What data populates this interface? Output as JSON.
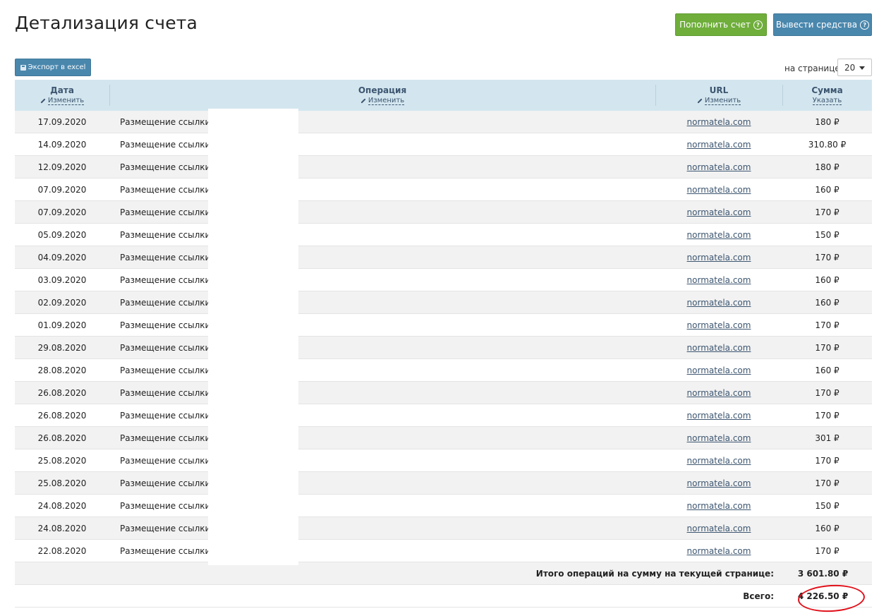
{
  "header": {
    "title": "Детализация счета",
    "topup_label": "Пополнить счет",
    "withdraw_label": "Вывести средства",
    "help_glyph": "?"
  },
  "toolbar": {
    "export_label": "Экспорт в excel",
    "per_page_label": "на странице",
    "per_page_value": "20"
  },
  "table": {
    "columns": [
      {
        "label": "Дата",
        "action": "Изменить"
      },
      {
        "label": "Операция",
        "action": "Изменить"
      },
      {
        "label": "URL",
        "action": "Изменить"
      },
      {
        "label": "Сумма",
        "action": "Указать"
      }
    ],
    "rows": [
      {
        "date": "17.09.2020",
        "op": "Размещение ссылки на",
        "url": "normatela.com",
        "sum": "180 ₽"
      },
      {
        "date": "14.09.2020",
        "op": "Размещение ссылки на",
        "url": "normatela.com",
        "sum": "310.80 ₽"
      },
      {
        "date": "12.09.2020",
        "op": "Размещение ссылки на",
        "url": "normatela.com",
        "sum": "180 ₽"
      },
      {
        "date": "07.09.2020",
        "op": "Размещение ссылки на",
        "url": "normatela.com",
        "sum": "160 ₽"
      },
      {
        "date": "07.09.2020",
        "op": "Размещение ссылки на",
        "url": "normatela.com",
        "sum": "170 ₽"
      },
      {
        "date": "05.09.2020",
        "op": "Размещение ссылки на",
        "url": "normatela.com",
        "sum": "150 ₽"
      },
      {
        "date": "04.09.2020",
        "op": "Размещение ссылки на",
        "url": "normatela.com",
        "sum": "170 ₽"
      },
      {
        "date": "03.09.2020",
        "op": "Размещение ссылки на",
        "url": "normatela.com",
        "sum": "160 ₽"
      },
      {
        "date": "02.09.2020",
        "op": "Размещение ссылки на",
        "url": "normatela.com",
        "sum": "160 ₽"
      },
      {
        "date": "01.09.2020",
        "op": "Размещение ссылки на",
        "url": "normatela.com",
        "sum": "170 ₽"
      },
      {
        "date": "29.08.2020",
        "op": "Размещение ссылки на",
        "url": "normatela.com",
        "sum": "170 ₽"
      },
      {
        "date": "28.08.2020",
        "op": "Размещение ссылки на",
        "url": "normatela.com",
        "sum": "160 ₽"
      },
      {
        "date": "26.08.2020",
        "op": "Размещение ссылки на",
        "url": "normatela.com",
        "sum": "170 ₽"
      },
      {
        "date": "26.08.2020",
        "op": "Размещение ссылки на",
        "url": "normatela.com",
        "sum": "170 ₽"
      },
      {
        "date": "26.08.2020",
        "op": "Размещение ссылки на",
        "url": "normatela.com",
        "sum": "301 ₽"
      },
      {
        "date": "25.08.2020",
        "op": "Размещение ссылки на",
        "url": "normatela.com",
        "sum": "170 ₽"
      },
      {
        "date": "25.08.2020",
        "op": "Размещение ссылки на",
        "url": "normatela.com",
        "sum": "170 ₽"
      },
      {
        "date": "24.08.2020",
        "op": "Размещение ссылки на",
        "url": "normatela.com",
        "sum": "150 ₽"
      },
      {
        "date": "24.08.2020",
        "op": "Размещение ссылки на",
        "url": "normatela.com",
        "sum": "160 ₽"
      },
      {
        "date": "22.08.2020",
        "op": "Размещение ссылки на",
        "url": "normatela.com",
        "sum": "170 ₽"
      }
    ],
    "page_total_label": "Итого операций на сумму на текущей странице:",
    "page_total_value": "3 601.80 ₽",
    "grand_total_label": "Всего:",
    "grand_total_value": "4 226.50 ₽"
  },
  "colors": {
    "green_button": "#6fae3b",
    "blue_button": "#4a87ad",
    "header_bg": "#d3e6ef",
    "annotation_red": "#e0101a"
  }
}
